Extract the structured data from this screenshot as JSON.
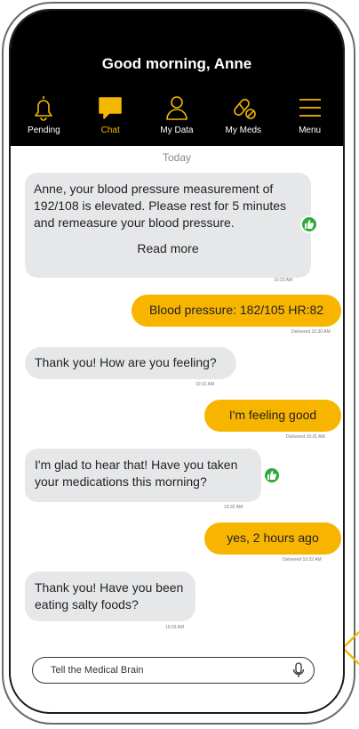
{
  "header": {
    "greeting": "Good morning, Anne"
  },
  "nav": {
    "pending": "Pending",
    "chat": "Chat",
    "my_data": "My Data",
    "my_meds": "My Meds",
    "menu": "Menu"
  },
  "chat": {
    "day_label": "Today",
    "messages": [
      {
        "text": "Anne, your blood pressure measurement of 192/108 is elevated. Please rest for 5 minutes and remeasure your blood pressure.",
        "link": "Read more",
        "time": "10:22 AM"
      },
      {
        "text": "Blood pressure: 182/105 HR:82",
        "time": "Delivered 10:30 AM"
      },
      {
        "text": "Thank you! How are you feeling?",
        "time": "10:31 AM"
      },
      {
        "text": "I'm feeling good",
        "time": "Delivered 10:31 AM"
      },
      {
        "text": "I'm glad to hear that! Have you taken your medications this morning?",
        "time": "10:32 AM"
      },
      {
        "text": "yes, 2 hours ago",
        "time": "Delivered 10:32 AM"
      },
      {
        "text": "Thank you! Have you been eating salty foods?",
        "time": "10:33 AM"
      }
    ]
  },
  "input": {
    "placeholder": "Tell the Medical Brain"
  },
  "colors": {
    "accent": "#f7b500",
    "header_bg": "#000000",
    "bot_bubble": "#e6e7e9",
    "thumb": "#2eaa3a"
  },
  "icons": [
    "bell-icon",
    "chat-bubble-icon",
    "person-icon",
    "pills-icon",
    "menu-icon",
    "thumbs-up-icon",
    "microphone-icon"
  ]
}
